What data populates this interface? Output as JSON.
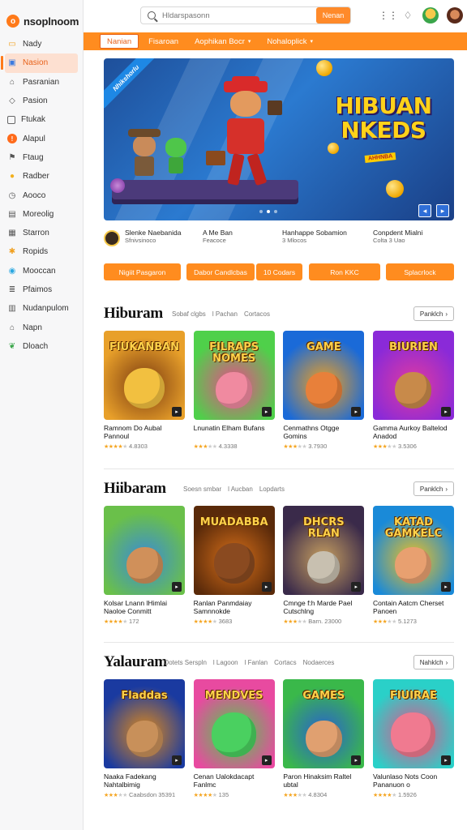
{
  "app": {
    "name": "nsoplnoom",
    "logo_letter": "o"
  },
  "sidebar": {
    "items": [
      {
        "label": "Nady",
        "icon": "folder-icon"
      },
      {
        "label": "Nasion",
        "icon": "image-icon",
        "active": true
      },
      {
        "label": "Pasranian",
        "icon": "home-icon"
      },
      {
        "label": "Pasion",
        "icon": "tag-icon"
      },
      {
        "label": "Ftukak",
        "icon": "square-icon"
      },
      {
        "label": "Alapul",
        "icon": "circle-badge-icon"
      },
      {
        "label": "Ftaug",
        "icon": "flag-icon"
      },
      {
        "label": "Radber",
        "icon": "coin-icon"
      },
      {
        "label": "Aooco",
        "icon": "clock-icon"
      },
      {
        "label": "Moreolig",
        "icon": "grid-icon"
      },
      {
        "label": "Starron",
        "icon": "box-icon"
      },
      {
        "label": "Ropids",
        "icon": "puzzle-icon"
      },
      {
        "label": "Mooccan",
        "icon": "globe-icon"
      },
      {
        "label": "Pfaimos",
        "icon": "list-icon"
      },
      {
        "label": "Nudanpulom",
        "icon": "table-icon"
      },
      {
        "label": "Napn",
        "icon": "house-icon"
      },
      {
        "label": "Dloach",
        "icon": "leaf-icon"
      }
    ]
  },
  "header": {
    "search_placeholder": "Hldarspasonn",
    "search_button": "Nenan"
  },
  "nav": {
    "tabs": [
      {
        "label": "Nanian",
        "active": true
      },
      {
        "label": "Fisaroan"
      },
      {
        "label": "Aophikan Bocr",
        "caret": true
      },
      {
        "label": "Nohaloplick",
        "caret": true
      }
    ]
  },
  "banner": {
    "ribbon": "Nhikshorlu",
    "title": "HIBUAN NKEDS",
    "subtitle": "AHHNBA",
    "info": [
      {
        "title": "Slenke Naebanida",
        "sub": "Sfnivsinoco"
      },
      {
        "title": "A Me Ban",
        "sub": "Feacoce"
      },
      {
        "title": "Hanhappe Sobamion",
        "sub": "3 Mlocos"
      },
      {
        "title": "Conpdent Mialni",
        "sub": "Colta 3 Uao"
      }
    ]
  },
  "actions": [
    "Nigiit Pasgaron",
    "Dabor Candlcbas",
    "10 Codars",
    "Ron KKC",
    "Splacrlock"
  ],
  "sections": [
    {
      "title": "Hiburam",
      "links": [
        "Sobaf clgbs",
        "l Pachan",
        "Cortacos"
      ],
      "more": "Panklch",
      "cards": [
        {
          "name": "Ramnom Do Aubal Pannoul",
          "rating": "4.8303",
          "stars": 4,
          "thumb_title": "FIUKANBAN"
        },
        {
          "name": "Lnunatin Elham Bufans",
          "rating": "4.3338",
          "stars": 3,
          "thumb_title": "FILRAPS NOMES"
        },
        {
          "name": "Cenmathns Otgge Gomins",
          "rating": "3.7930",
          "stars": 3,
          "thumb_title": "GAME"
        },
        {
          "name": "Gamma Aurkoy Baltelod Anadod",
          "rating": "3.5306",
          "stars": 3,
          "thumb_title": "BIURIEN"
        }
      ]
    },
    {
      "title": "Hiibaram",
      "links": [
        "Soesn smbar",
        "l Aucban",
        "Lopdarts"
      ],
      "more": "Panklch",
      "cards": [
        {
          "name": "Kolsar Lnann lHimlai Naoloe Conmitt",
          "rating": "172",
          "stars": 4,
          "thumb_title": ""
        },
        {
          "name": "Ranlan Panmdaiay Samnnokde",
          "rating": "3683",
          "stars": 4,
          "thumb_title": "MUADABBA"
        },
        {
          "name": "Cmnge f:h Marde Pael Cutschlng",
          "rating": "Barn. 23000",
          "stars": 3,
          "thumb_title": "DHCRS RLAN"
        },
        {
          "name": "Contain Aatcm Cherset Panoen",
          "rating": "5.1273",
          "stars": 3,
          "thumb_title": "KATAD GAMKELC"
        }
      ]
    },
    {
      "title": "Yalauram",
      "links": [
        "Ootets Serspln",
        "l Lagoon",
        "l Fanlan",
        "Cortacs",
        "Nodaerces"
      ],
      "more": "Nahklch",
      "cards": [
        {
          "name": "Naaka Fadekang Nahtalbimig",
          "rating": "Caabsdon 35391",
          "stars": 3,
          "thumb_title": "Fladdas"
        },
        {
          "name": "Cenan Ualokdacapt Fanlmc",
          "rating": "135",
          "stars": 4,
          "thumb_title": "MENDVES"
        },
        {
          "name": "Paron Hinaksim Raltel ubtal",
          "rating": "4.8304",
          "stars": 3,
          "thumb_title": "GAMES"
        },
        {
          "name": "Valunlaso Nots Coon Pananuon o",
          "rating": "1.5926",
          "stars": 4,
          "thumb_title": "FIUIRAE"
        }
      ]
    }
  ],
  "colors": {
    "accent": "#ff8c1f",
    "accent_dark": "#e8621a"
  }
}
